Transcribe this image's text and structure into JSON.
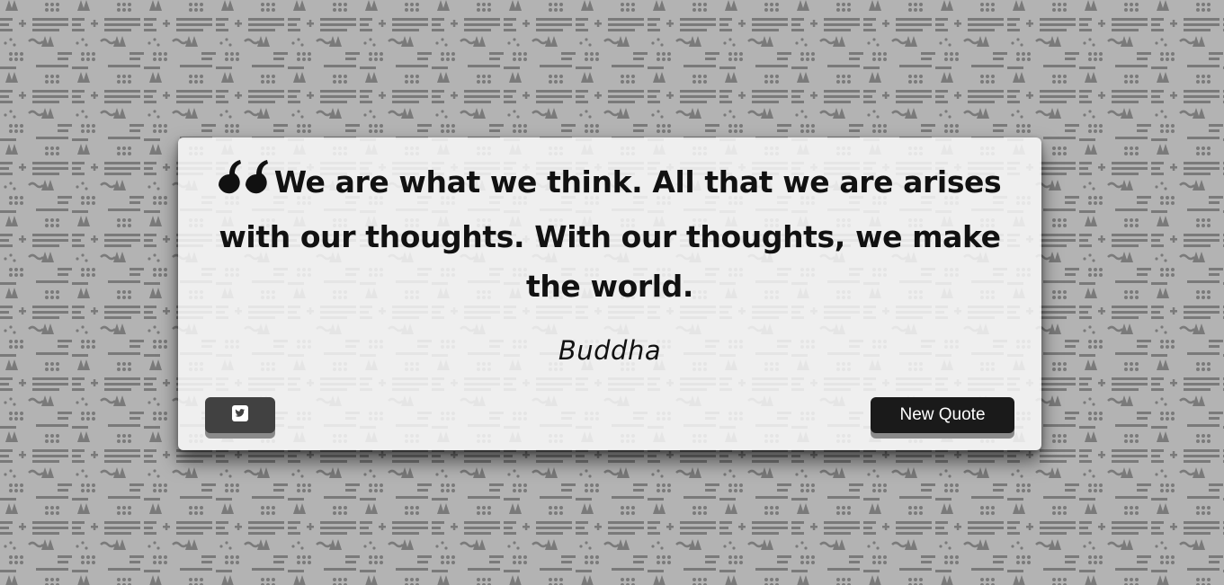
{
  "colors": {
    "page_background": "#b3b3b3",
    "pattern_marks": "#7a7a7a",
    "card_background": "#efefef",
    "text": "#111111",
    "tweet_button": "#414141",
    "new_quote_button": "#1a1a1a",
    "button_text": "#ffffff"
  },
  "quote": {
    "icon": "quote-left-icon",
    "text": "We are what we think. All that we are arises with our thoughts. With our thoughts, we make the world.",
    "author": "Buddha"
  },
  "actions": {
    "tweet_icon": "twitter-icon",
    "new_quote_label": "New Quote"
  }
}
